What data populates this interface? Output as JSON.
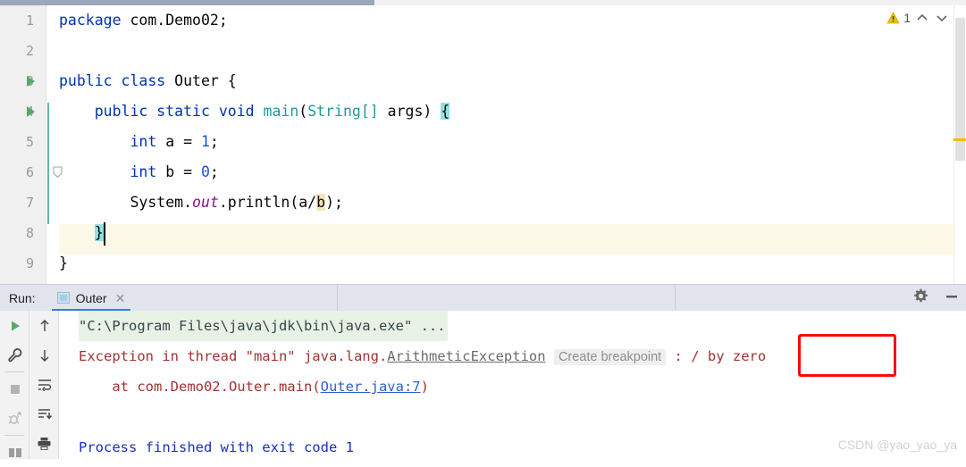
{
  "editor": {
    "scrollbar": {
      "top_thumb": "horizontal-scroll-thumb"
    },
    "inspection": {
      "warning_icon": "warning-triangle-icon",
      "warning_count": "1",
      "prev_icon": "chevron-up-icon",
      "next_icon": "chevron-down-icon"
    },
    "lines": [
      {
        "num": "1",
        "run_marker": false,
        "text": "package com.Demo02;"
      },
      {
        "num": "2",
        "run_marker": false,
        "text": ""
      },
      {
        "num": "3",
        "run_marker": true,
        "text": "public class Outer {"
      },
      {
        "num": "4",
        "run_marker": true,
        "text": "    public static void main(String[] args) {"
      },
      {
        "num": "5",
        "run_marker": false,
        "text": "        int a = 1;"
      },
      {
        "num": "6",
        "run_marker": false,
        "text": "        int b = 0;"
      },
      {
        "num": "7",
        "run_marker": false,
        "text": "        System.out.println(a/b);"
      },
      {
        "num": "8",
        "run_marker": false,
        "text": "    }"
      },
      {
        "num": "9",
        "run_marker": false,
        "text": "}"
      }
    ],
    "tokens": {
      "l1_kw": "package",
      "l1_rest": " com.Demo02;",
      "l3_kw1": "public",
      "l3_kw2": "class",
      "l3_cls": "Outer",
      "l3_brace": "{",
      "l4_kw1": "public",
      "l4_kw2": "static",
      "l4_kw3": "void",
      "l4_method": "main",
      "l4_paren1": "(",
      "l4_type": "String[]",
      "l4_arg": " args",
      "l4_paren2": ") ",
      "l4_brace": "{",
      "l5_kw": "int",
      "l5_mid": " a = ",
      "l5_num": "1",
      "l5_end": ";",
      "l6_kw": "int",
      "l6_mid": " b = ",
      "l6_num": "0",
      "l6_end": ";",
      "l7_sys": "System.",
      "l7_out": "out",
      "l7_mid": ".println(a/",
      "l7_b": "b",
      "l7_end": ");",
      "l8_brace": "}",
      "l9_brace": "}"
    }
  },
  "run_panel": {
    "label": "Run:",
    "tab": {
      "name": "Outer",
      "icon": "console-tab-icon",
      "close_icon": "close-icon"
    },
    "settings_icon": "gear-icon",
    "minimize_icon": "minimize-icon",
    "toolbar_left": [
      {
        "name": "rerun-button",
        "icon": "green-play-icon"
      },
      {
        "name": "edit-configuration-button",
        "icon": "wrench-icon"
      },
      {
        "name": "stop-button",
        "icon": "stop-square-icon"
      },
      {
        "name": "rerun-failed-button",
        "icon": "rerun-failed-icon"
      }
    ],
    "toolbar_right": [
      {
        "name": "up-occurrence-button",
        "icon": "arrow-up-icon"
      },
      {
        "name": "down-occurrence-button",
        "icon": "arrow-down-icon"
      },
      {
        "name": "soft-wrap-button",
        "icon": "soft-wrap-icon"
      },
      {
        "name": "scroll-to-end-button",
        "icon": "scroll-to-end-icon"
      },
      {
        "name": "print-button",
        "icon": "printer-icon"
      }
    ],
    "console": {
      "command_line": "\"C:\\Program Files\\java\\jdk\\bin\\java.exe\" ...",
      "exception_prefix": "Exception in thread \"main\" java.lang.",
      "exception_class": "ArithmeticException",
      "create_breakpoint": "Create breakpoint",
      "exception_sep": " : / ",
      "exception_msg": "by zero",
      "stack_prefix": "    at com.Demo02.Outer.main(",
      "stack_link": "Outer.java:7",
      "stack_suffix": ")",
      "finish_line": "Process finished with exit code 1"
    }
  },
  "annotation": {
    "redbox": "red-highlight-box"
  },
  "watermark": "CSDN @yao_yao_ya",
  "colors": {
    "keyword": "#0033b3",
    "number": "#1750eb",
    "class": "#20999d",
    "field": "#871094",
    "error": "#a03232",
    "link": "#2f5fd0",
    "success": "#1c2fbf",
    "accent": "#3d7dcc",
    "annotation": "#fa0a0a",
    "warning": "#ecc000"
  }
}
